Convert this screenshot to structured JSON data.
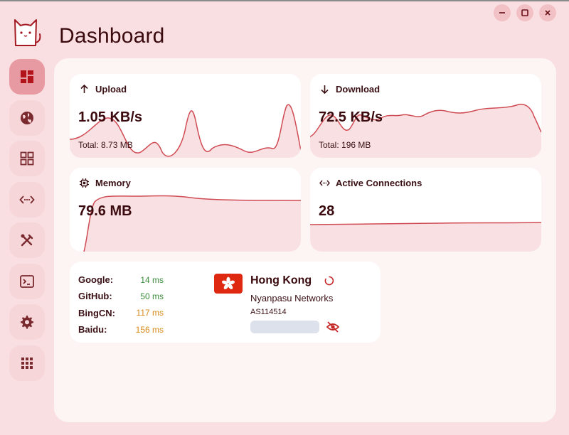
{
  "app": {
    "title": "Dashboard"
  },
  "window_controls": {
    "minimize": "minimize",
    "maximize": "maximize",
    "close": "close"
  },
  "sidebar": {
    "items": [
      {
        "id": "dashboard",
        "icon": "dashboard-icon",
        "active": true
      },
      {
        "id": "proxies",
        "icon": "globe-icon",
        "active": false
      },
      {
        "id": "profiles",
        "icon": "grid-icon",
        "active": false
      },
      {
        "id": "connections",
        "icon": "code-arrows-icon",
        "active": false
      },
      {
        "id": "rules",
        "icon": "tools-icon",
        "active": false
      },
      {
        "id": "logs",
        "icon": "terminal-icon",
        "active": false
      },
      {
        "id": "settings",
        "icon": "gear-icon",
        "active": false
      },
      {
        "id": "providers",
        "icon": "apps-icon",
        "active": false
      }
    ]
  },
  "cards": {
    "upload": {
      "title": "Upload",
      "value": "1.05 KB/s",
      "total": "Total: 8.73 MB"
    },
    "download": {
      "title": "Download",
      "value": "72.5 KB/s",
      "total": "Total: 196 MB"
    },
    "memory": {
      "title": "Memory",
      "value": "79.6 MB"
    },
    "connections": {
      "title": "Active Connections",
      "value": "28"
    }
  },
  "latency": [
    {
      "name": "Google:",
      "ms": "14 ms",
      "color": "#3a8a3a"
    },
    {
      "name": "GitHub:",
      "ms": "50 ms",
      "color": "#3a8a3a"
    },
    {
      "name": "BingCN:",
      "ms": "117 ms",
      "color": "#d98a1a"
    },
    {
      "name": "Baidu:",
      "ms": "156 ms",
      "color": "#d98a1a"
    }
  ],
  "ip_info": {
    "country": "Hong Kong",
    "isp": "Nyanpasu Networks",
    "asn": "AS114514"
  },
  "colors": {
    "accent": "#c62828",
    "background": "#f9dfe1",
    "panel": "#fdf4f4",
    "active_nav": "#e79aa1",
    "chart_fill": "#f9e1e3",
    "chart_line": "#cf4a52"
  }
}
